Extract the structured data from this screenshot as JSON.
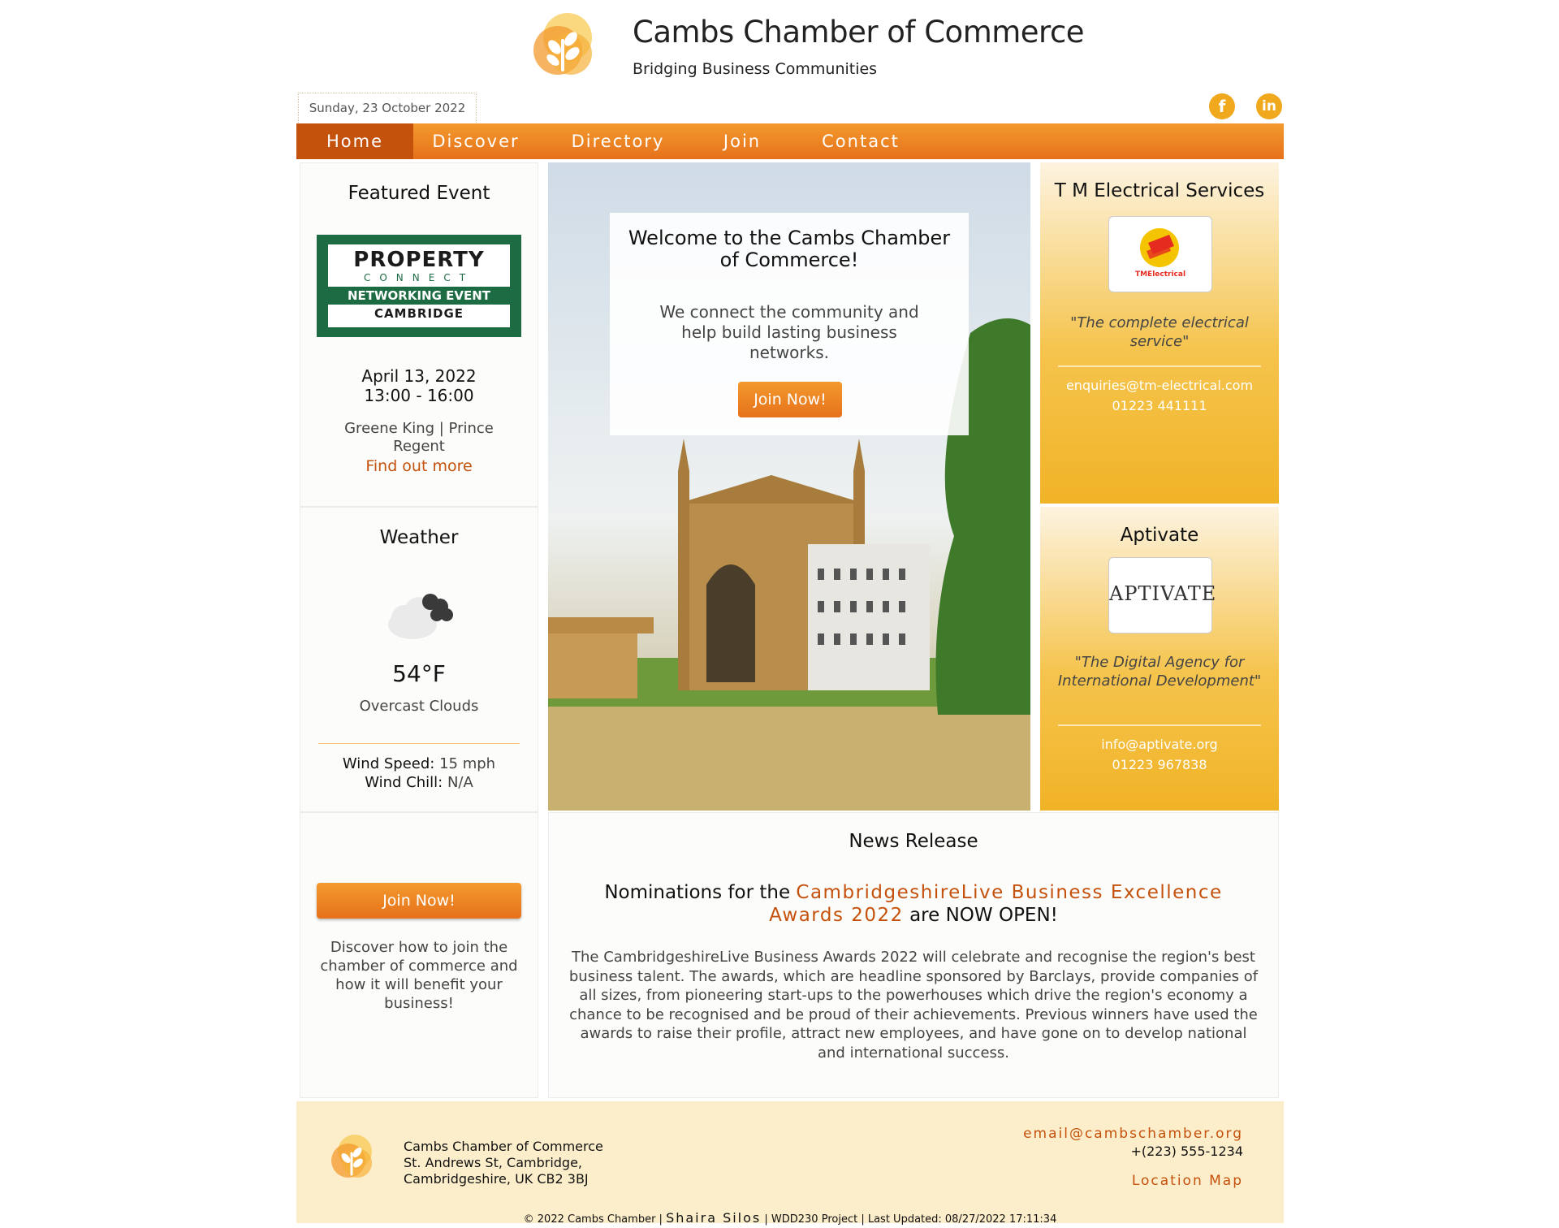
{
  "header": {
    "title": "Cambs Chamber of Commerce",
    "tagline": "Bridging Business Communities",
    "date": "Sunday, 23 October 2022",
    "social": [
      "facebook-icon",
      "linkedin-icon"
    ]
  },
  "nav": {
    "items": [
      {
        "label": "Home",
        "active": true
      },
      {
        "label": "Discover",
        "active": false
      },
      {
        "label": "Directory",
        "active": false
      },
      {
        "label": "Join",
        "active": false
      },
      {
        "label": "Contact",
        "active": false
      }
    ]
  },
  "event": {
    "title": "Featured Event",
    "banner_line1": "PROPERTY",
    "banner_line2": "CONNECT",
    "banner_line3": "NETWORKING EVENT",
    "banner_line4": "CAMBRIDGE",
    "date": "April 13, 2022",
    "time": "13:00 - 16:00",
    "venue": "Greene King | Prince Regent",
    "link": "Find out more"
  },
  "weather": {
    "title": "Weather",
    "icon": "cloud-icon",
    "temp": "54°F",
    "condition": "Overcast Clouds",
    "wind_speed_label": "Wind Speed:",
    "wind_speed": "15 mph",
    "wind_chill_label": "Wind Chill:",
    "wind_chill": "N/A"
  },
  "join": {
    "button": "Join Now!",
    "text": "Discover how to join the chamber of commerce and how it will benefit your business!"
  },
  "hero": {
    "title": "Welcome to the Cambs Chamber of Commerce!",
    "text": "We connect the community and help build lasting business networks.",
    "button": "Join Now!"
  },
  "sponsors": [
    {
      "name": "T M Electrical Services",
      "logo_text": "TMElectrical",
      "quote": "\"The complete electrical service\"",
      "email": "enquiries@tm-electrical.com",
      "phone": "01223 441111"
    },
    {
      "name": "Aptivate",
      "logo_text": "APTIVATE",
      "quote": "\"The Digital Agency for International Development\"",
      "email": "info@aptivate.org",
      "phone": "01223 967838"
    }
  ],
  "news": {
    "title": "News Release",
    "headline_pre": "Nominations for the ",
    "headline_highlight": "CambridgeshireLive Business Excellence Awards 2022",
    "headline_post": " are NOW OPEN!",
    "body": "The CambridgeshireLive Business Awards 2022 will celebrate and recognise the region's best business talent. The awards, which are headline sponsored by Barclays, provide companies of all sizes, from pioneering start-ups to the powerhouses which drive the region's economy a chance to be recognised and be proud of their achievements. Previous winners have used the awards to raise their profile, attract new employees, and have gone on to develop national and international success."
  },
  "footer": {
    "org": "Cambs Chamber of Commerce",
    "address1": "St. Andrews St, Cambridge,",
    "address2": "Cambridgeshire, UK CB2 3BJ",
    "email": "email@cambschamber.org",
    "phone": "+(223) 555-1234",
    "map": "Location Map",
    "copy_pre": "© 2022  Cambs Chamber | ",
    "author": "Shaira Silos",
    "copy_post": " | WDD230 Project | Last Updated: 08/27/2022 17:11:34"
  },
  "colors": {
    "accent": "#e6711b",
    "accent_dark": "#c4510c",
    "sponsor_gold": "#f1b327",
    "footer_bg": "#fdeecb"
  }
}
